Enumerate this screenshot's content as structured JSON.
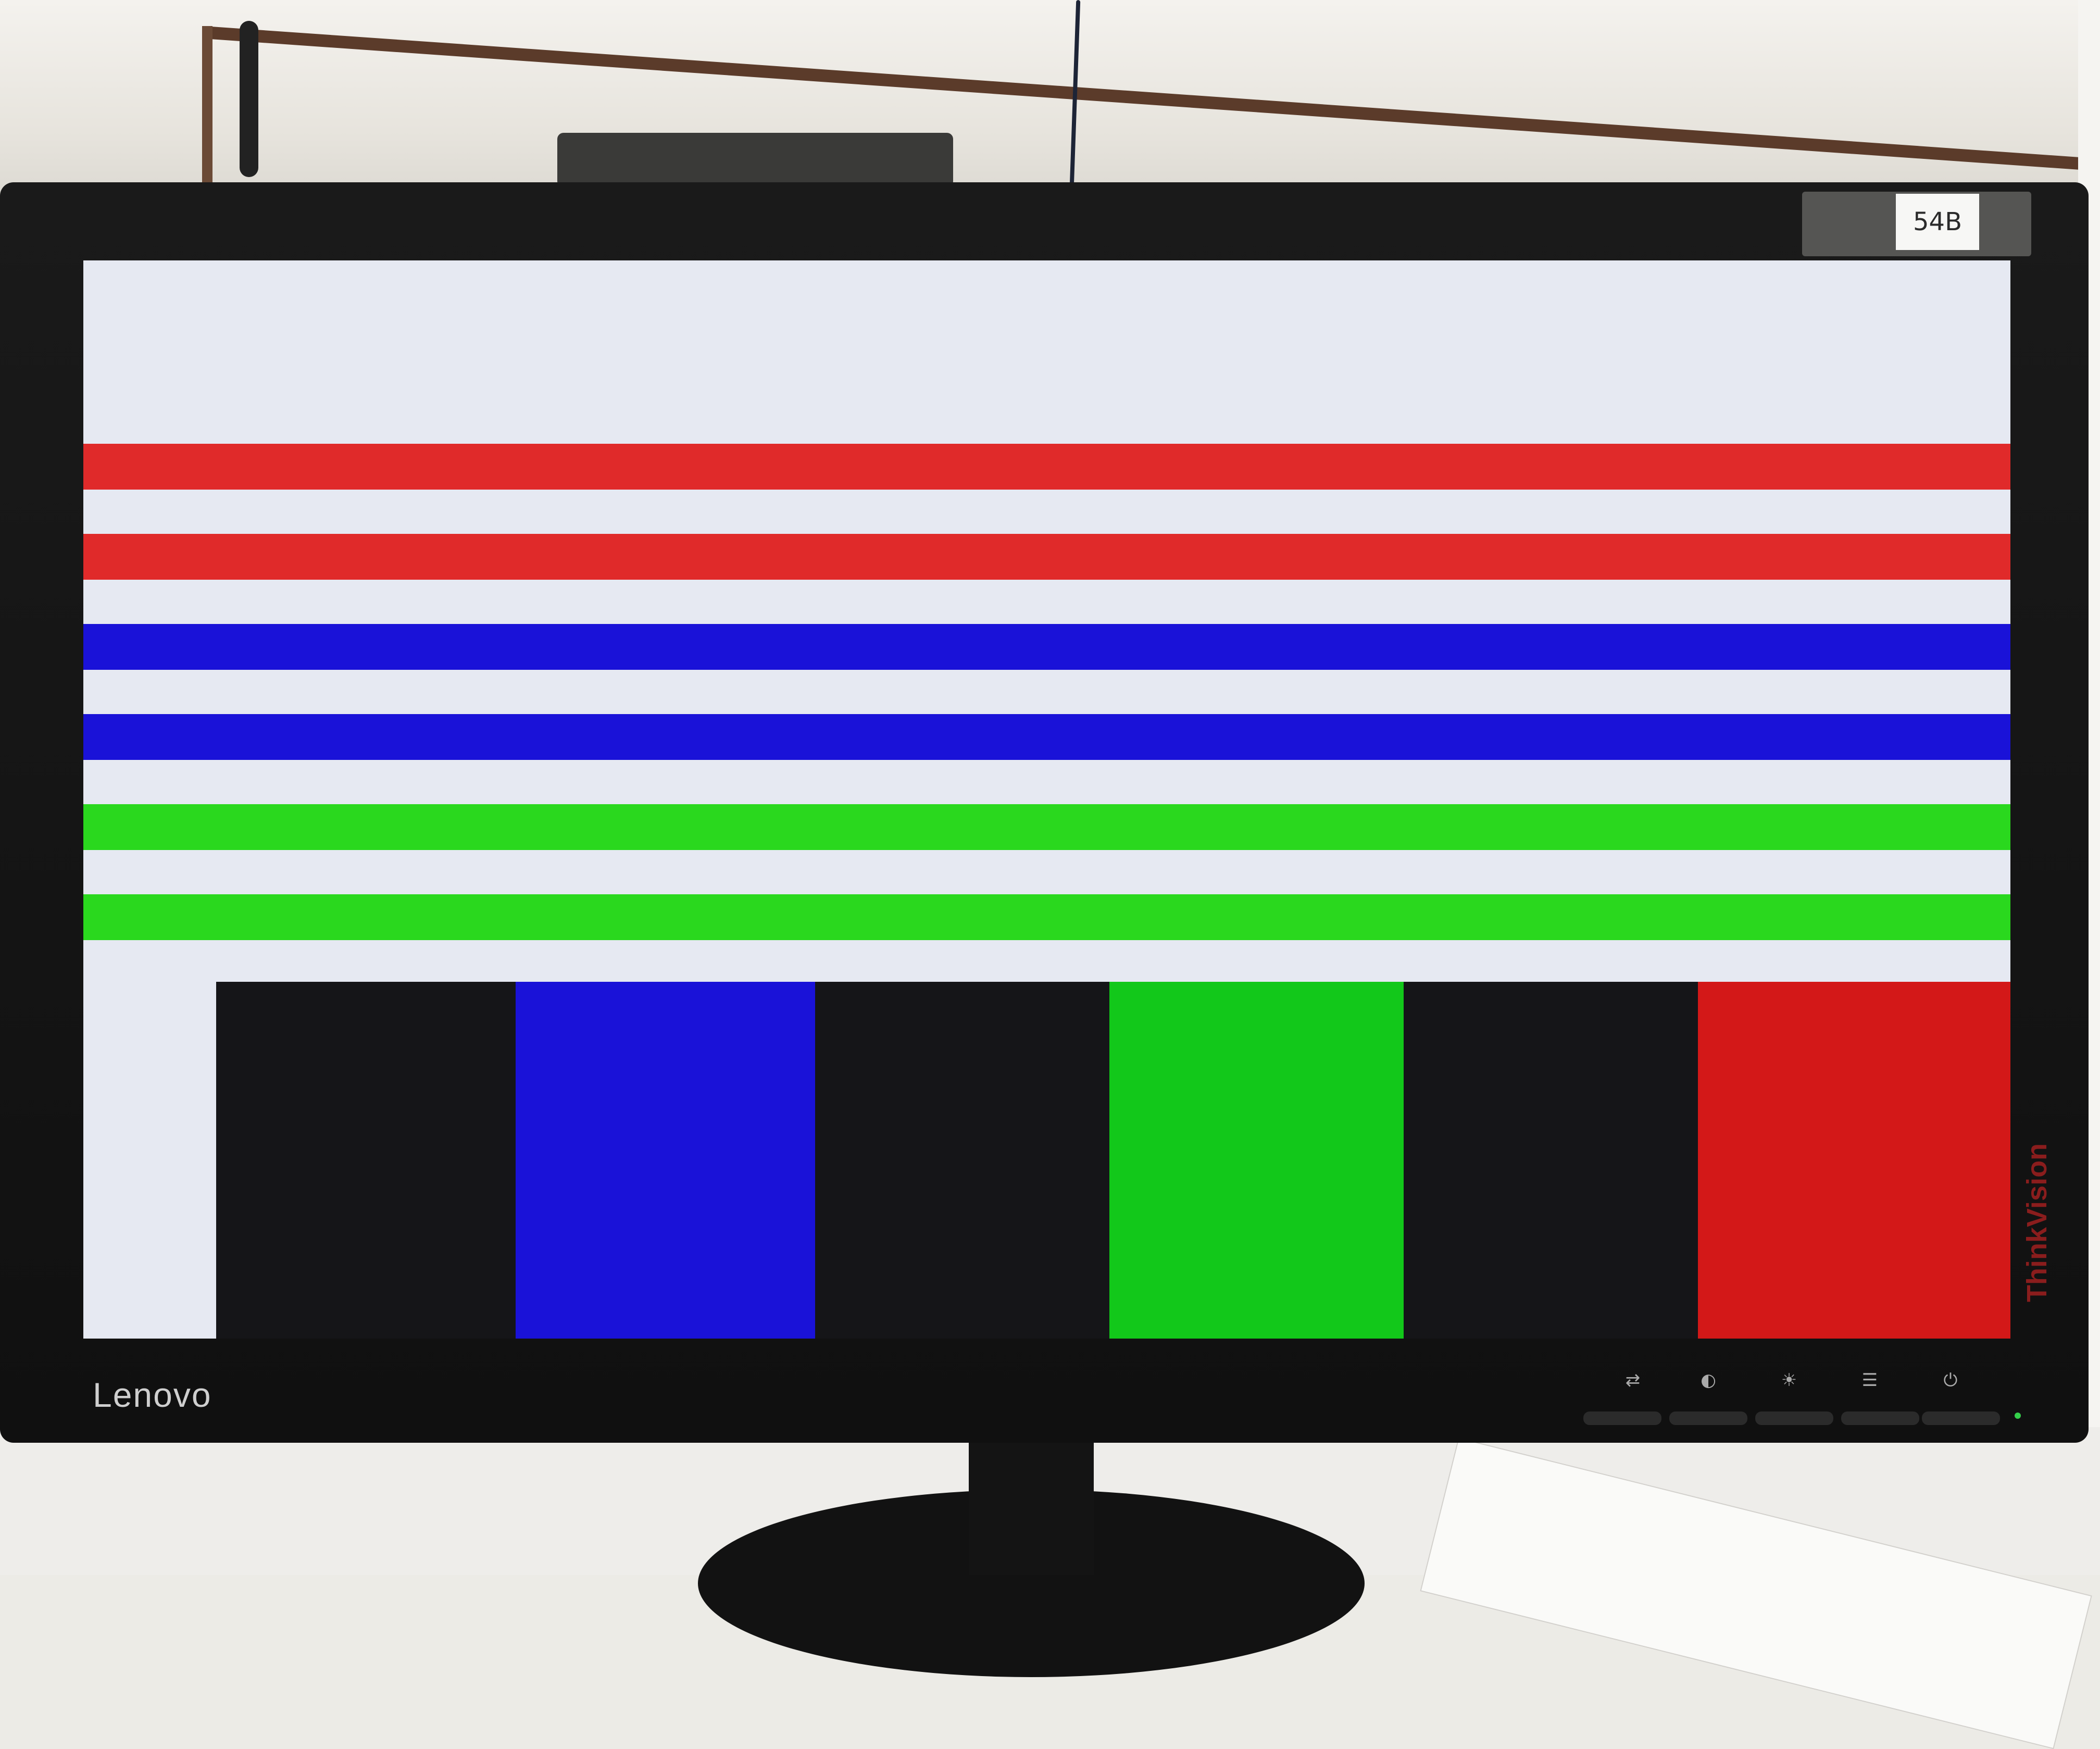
{
  "scene": {
    "asset_label": "54B",
    "brand": "Lenovo",
    "subbrand": "ThinkVision"
  },
  "screen": {
    "background_color": "#e6e9f2",
    "stripes": [
      {
        "name": "red-stripe-1",
        "color": "#e02a2a"
      },
      {
        "name": "red-stripe-2",
        "color": "#e02a2a"
      },
      {
        "name": "blue-stripe-1",
        "color": "#1a12d8"
      },
      {
        "name": "blue-stripe-2",
        "color": "#1a12d8"
      },
      {
        "name": "green-stripe-1",
        "color": "#2ad81e"
      },
      {
        "name": "green-stripe-2",
        "color": "#2ad81e"
      }
    ],
    "bars": [
      {
        "name": "black-bar-1",
        "color": "#151518"
      },
      {
        "name": "blue-bar",
        "color": "#1a12d8"
      },
      {
        "name": "black-bar-2",
        "color": "#151518"
      },
      {
        "name": "green-bar",
        "color": "#12c81a"
      },
      {
        "name": "black-bar-3",
        "color": "#151518"
      },
      {
        "name": "red-bar",
        "color": "#d31818"
      }
    ]
  },
  "controls": [
    {
      "name": "input-button",
      "icon": "input-switch-icon",
      "glyph": "⇄"
    },
    {
      "name": "mode-button",
      "icon": "low-blue-light-icon",
      "glyph": "◐"
    },
    {
      "name": "brightness-button",
      "icon": "brightness-icon",
      "glyph": "☀"
    },
    {
      "name": "menu-button",
      "icon": "menu-icon",
      "glyph": "☰"
    },
    {
      "name": "power-button",
      "icon": "power-icon",
      "glyph": "⏻"
    }
  ]
}
